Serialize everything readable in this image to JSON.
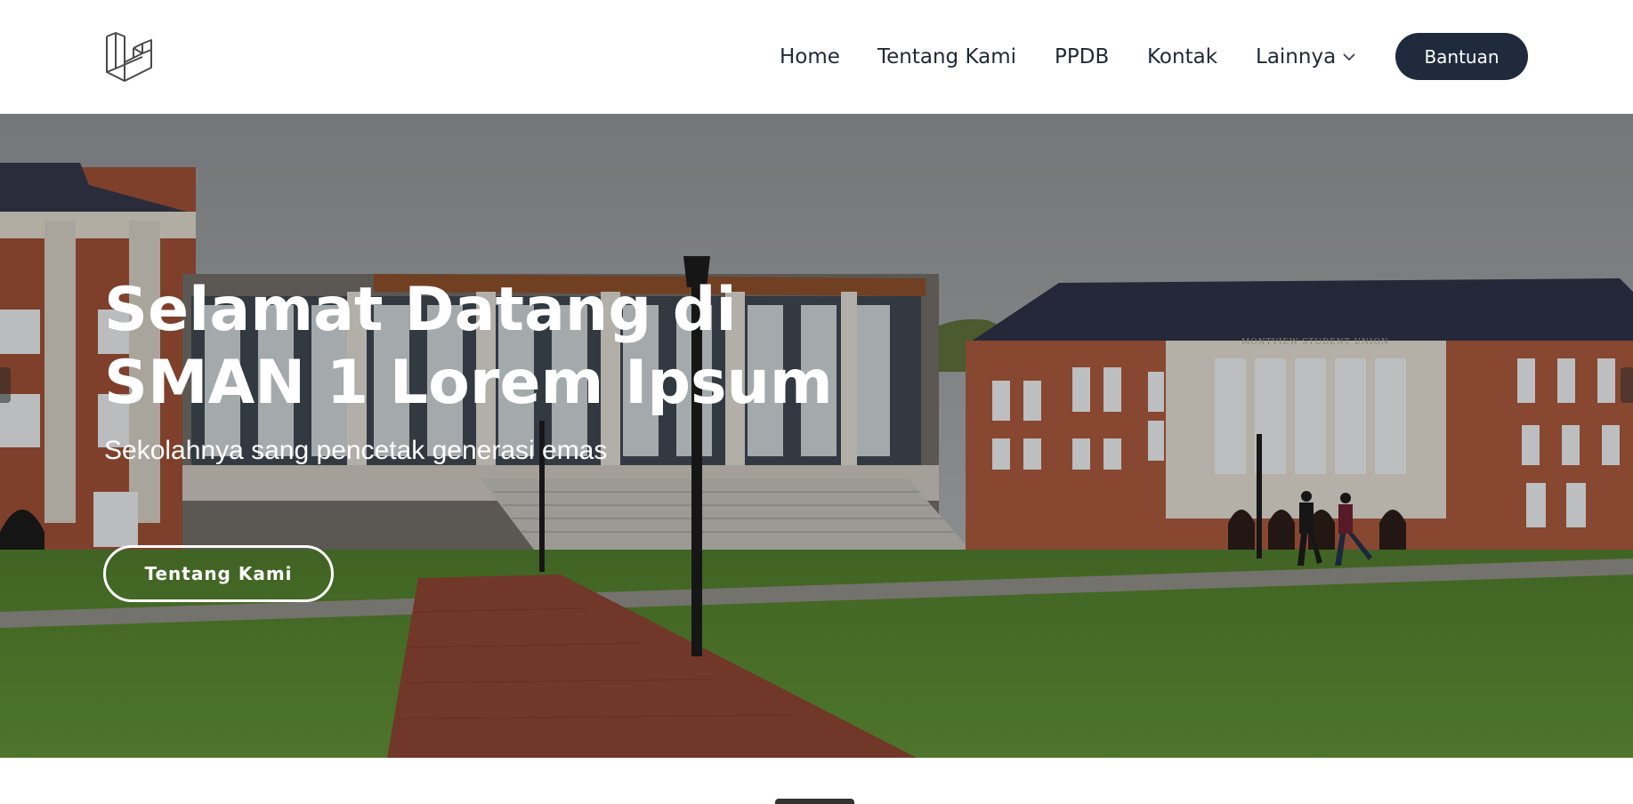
{
  "nav": {
    "home": "Home",
    "about": "Tentang Kami",
    "ppdb": "PPDB",
    "contact": "Kontak",
    "more": "Lainnya",
    "help": "Bantuan"
  },
  "hero": {
    "title_line1": "Selamat Datang di",
    "title_line2": "SMAN 1 Lorem Ipsum",
    "subtitle": "Sekolahnya sang pencetak generasi emas",
    "cta": "Tentang Kami",
    "building_sign": "MONTVIEW STUDENT UNION"
  },
  "colors": {
    "header_bg": "#ffffff",
    "nav_text": "#1f2937",
    "help_button_bg": "#1f2a3d",
    "hero_text": "#ffffff"
  },
  "icons": {
    "logo": "laravel-logo-icon",
    "chevron": "chevron-down-icon"
  }
}
